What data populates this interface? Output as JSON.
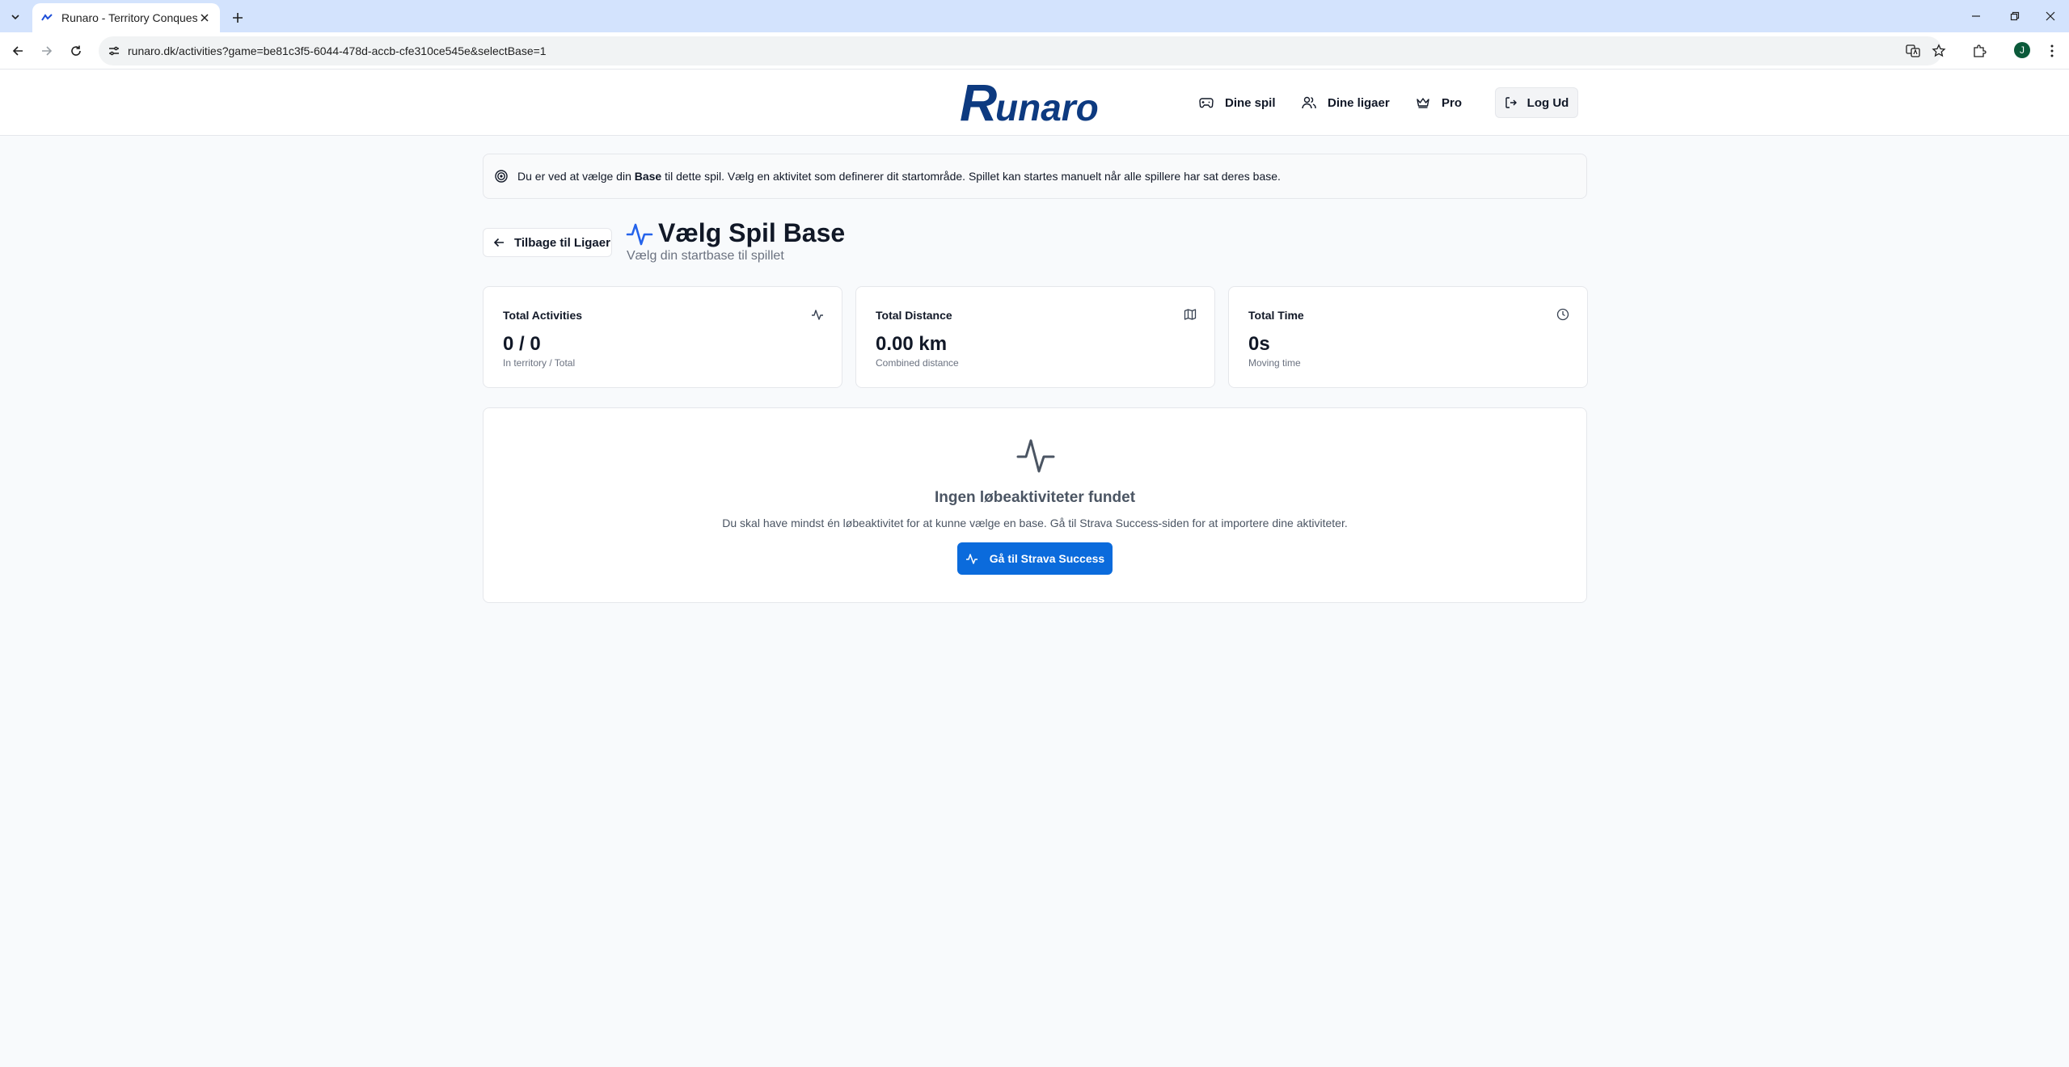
{
  "browser": {
    "tab_title": "Runaro - Territory Conquest",
    "url": "runaro.dk/activities?game=be81c3f5-6044-478d-accb-cfe310ce545e&selectBase=1",
    "profile_initial": "J"
  },
  "header": {
    "logo_text": "Runaro",
    "nav": {
      "games": "Dine spil",
      "leagues": "Dine ligaer",
      "pro": "Pro",
      "logout": "Log Ud"
    }
  },
  "alert": {
    "before": "Du er ved at vælge din ",
    "bold": "Base",
    "after": " til dette spil. Vælg en aktivitet som definerer dit startområde. Spillet kan startes manuelt når alle spillere har sat deres base."
  },
  "page": {
    "back_label": "Tilbage til Ligaer",
    "title": "Vælg Spil Base",
    "subtitle": "Vælg din startbase til spillet"
  },
  "stats": [
    {
      "label": "Total Activities",
      "value": "0 / 0",
      "sub": "In territory / Total",
      "icon": "activity-icon"
    },
    {
      "label": "Total Distance",
      "value": "0.00 km",
      "sub": "Combined distance",
      "icon": "map-icon"
    },
    {
      "label": "Total Time",
      "value": "0s",
      "sub": "Moving time",
      "icon": "clock-icon"
    }
  ],
  "empty": {
    "title": "Ingen løbeaktiviteter fundet",
    "text": "Du skal have mindst én løbeaktivitet for at kunne vælge en base. Gå til Strava Success-siden for at importere dine aktiviteter.",
    "button": "Gå til Strava Success"
  },
  "colors": {
    "primary": "#0b6bdc",
    "logo": "#0d3a80",
    "accent_icon": "#2563eb"
  }
}
